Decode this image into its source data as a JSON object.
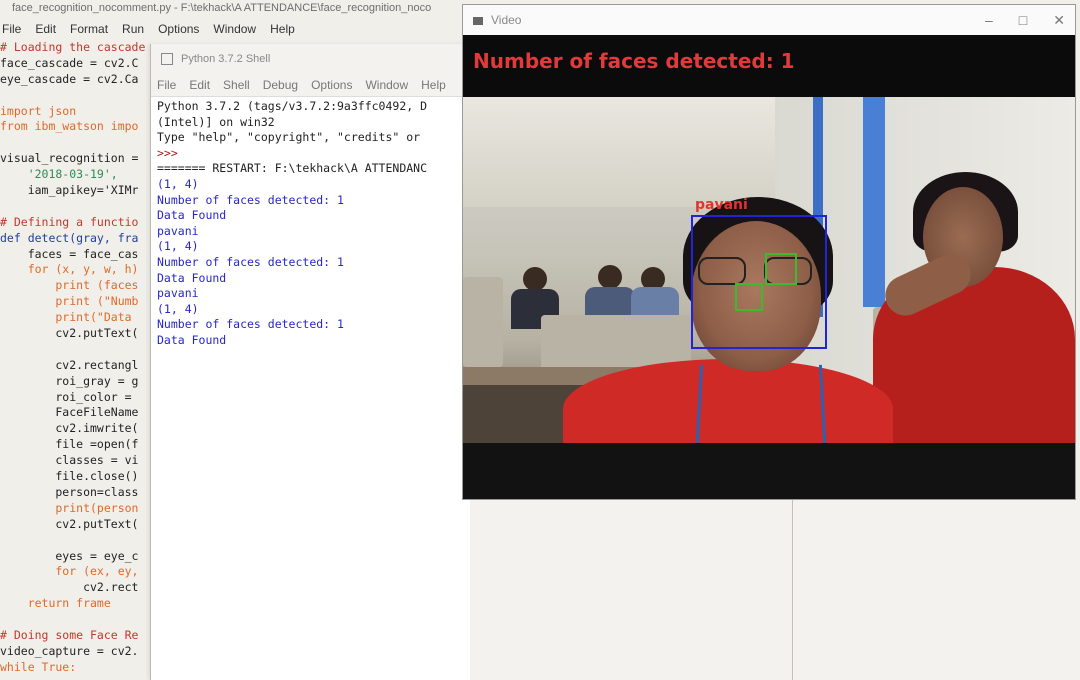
{
  "editor": {
    "title": "face_recognition_nocomment.py - F:\\tekhack\\A ATTENDANCE\\face_recognition_noco",
    "menu": [
      "File",
      "Edit",
      "Format",
      "Run",
      "Options",
      "Window",
      "Help"
    ],
    "code_lines": [
      {
        "text": "# Loading the cascade",
        "kind": "comment"
      },
      {
        "text": "face_cascade = cv2.C",
        "kind": "code"
      },
      {
        "text": "eye_cascade = cv2.Ca",
        "kind": "code"
      },
      {
        "text": "",
        "kind": "code"
      },
      {
        "text": "import json",
        "kind": "kw"
      },
      {
        "text": "from ibm_watson impo",
        "kind": "kw"
      },
      {
        "text": "",
        "kind": "code"
      },
      {
        "text": "visual_recognition =",
        "kind": "code"
      },
      {
        "text": "    '2018-03-19',",
        "kind": "str"
      },
      {
        "text": "    iam_apikey='XIMr",
        "kind": "code"
      },
      {
        "text": "",
        "kind": "code"
      },
      {
        "text": "# Defining a functio",
        "kind": "comment"
      },
      {
        "text": "def detect(gray, fra",
        "kind": "fn"
      },
      {
        "text": "    faces = face_cas",
        "kind": "code"
      },
      {
        "text": "    for (x, y, w, h)",
        "kind": "kw"
      },
      {
        "text": "        print (faces",
        "kind": "kw"
      },
      {
        "text": "        print (\"Numb",
        "kind": "kw"
      },
      {
        "text": "        print(\"Data ",
        "kind": "kw"
      },
      {
        "text": "        cv2.putText(",
        "kind": "code"
      },
      {
        "text": "",
        "kind": "code"
      },
      {
        "text": "        cv2.rectangl",
        "kind": "code"
      },
      {
        "text": "        roi_gray = g",
        "kind": "code"
      },
      {
        "text": "        roi_color = ",
        "kind": "code"
      },
      {
        "text": "        FaceFileName",
        "kind": "code"
      },
      {
        "text": "        cv2.imwrite(",
        "kind": "code"
      },
      {
        "text": "        file =open(f",
        "kind": "code"
      },
      {
        "text": "        classes = vi",
        "kind": "code"
      },
      {
        "text": "        file.close()",
        "kind": "code"
      },
      {
        "text": "        person=class",
        "kind": "code"
      },
      {
        "text": "        print(person",
        "kind": "kw"
      },
      {
        "text": "        cv2.putText(",
        "kind": "code"
      },
      {
        "text": "",
        "kind": "code"
      },
      {
        "text": "        eyes = eye_c",
        "kind": "code"
      },
      {
        "text": "        for (ex, ey,",
        "kind": "kw"
      },
      {
        "text": "            cv2.rect",
        "kind": "code"
      },
      {
        "text": "    return frame",
        "kind": "kw"
      },
      {
        "text": "",
        "kind": "code"
      },
      {
        "text": "# Doing some Face Re",
        "kind": "comment"
      },
      {
        "text": "video_capture = cv2.",
        "kind": "code"
      },
      {
        "text": "while True:",
        "kind": "kw"
      }
    ]
  },
  "shell": {
    "title": "Python 3.7.2 Shell",
    "menu": [
      "File",
      "Edit",
      "Shell",
      "Debug",
      "Options",
      "Window",
      "Help"
    ],
    "lines": [
      {
        "text": "Python 3.7.2 (tags/v3.7.2:9a3ffc0492, D",
        "kind": "plain"
      },
      {
        "text": "(Intel)] on win32",
        "kind": "plain"
      },
      {
        "text": "Type \"help\", \"copyright\", \"credits\" or",
        "kind": "plain"
      },
      {
        "text": ">>>",
        "kind": "red"
      },
      {
        "text": "======= RESTART: F:\\tekhack\\A ATTENDANC",
        "kind": "plain"
      },
      {
        "text": "(1, 4)",
        "kind": "blue"
      },
      {
        "text": "Number of faces detected: 1",
        "kind": "blue"
      },
      {
        "text": "Data Found",
        "kind": "blue"
      },
      {
        "text": "pavani",
        "kind": "blue"
      },
      {
        "text": "(1, 4)",
        "kind": "blue"
      },
      {
        "text": "Number of faces detected: 1",
        "kind": "blue"
      },
      {
        "text": "Data Found",
        "kind": "blue"
      },
      {
        "text": "pavani",
        "kind": "blue"
      },
      {
        "text": "(1, 4)",
        "kind": "blue"
      },
      {
        "text": "Number of faces detected: 1",
        "kind": "blue"
      },
      {
        "text": "Data Found",
        "kind": "blue"
      }
    ]
  },
  "video": {
    "title": "Video",
    "controls": [
      "–",
      "□",
      "✕"
    ],
    "overlay_text": "Number of faces detected: 1",
    "face_label": "pavani",
    "colors": {
      "overlay": "#e23a3a",
      "face_box": "#2324d8",
      "eye_box": "#3dbb2e"
    }
  }
}
